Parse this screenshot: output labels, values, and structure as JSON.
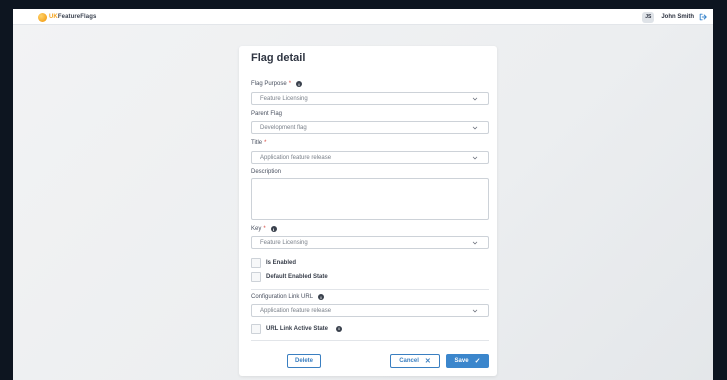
{
  "header": {
    "logo_accent": "UK",
    "logo_main": "FeatureFlags",
    "user_initials": "JS",
    "user_name": "John Smith"
  },
  "form": {
    "title": "Flag detail",
    "flag_purpose": {
      "label": "Flag Purpose",
      "required": "*",
      "value": "Feature Licensing"
    },
    "parent_flag": {
      "label": "Parent Flag",
      "value": "Development flag"
    },
    "title_field": {
      "label": "Title",
      "required": "*",
      "value": "Application feature release"
    },
    "description": {
      "label": "Description",
      "value": ""
    },
    "key": {
      "label": "Key",
      "required": "*",
      "value": "Feature Licensing"
    },
    "is_enabled": {
      "label": "Is Enabled"
    },
    "default_enabled_state": {
      "label": "Default Enabled State"
    },
    "configuration_link_url": {
      "label": "Configuration Link URL",
      "value": "Application feature release"
    },
    "url_link_active_state": {
      "label": "URL Link Active State"
    }
  },
  "actions": {
    "delete_label": "Delete",
    "cancel_label": "Cancel",
    "save_label": "Save"
  },
  "colors": {
    "accent": "#f5a623",
    "primary": "#3b86cc",
    "required": "#d6453d"
  }
}
